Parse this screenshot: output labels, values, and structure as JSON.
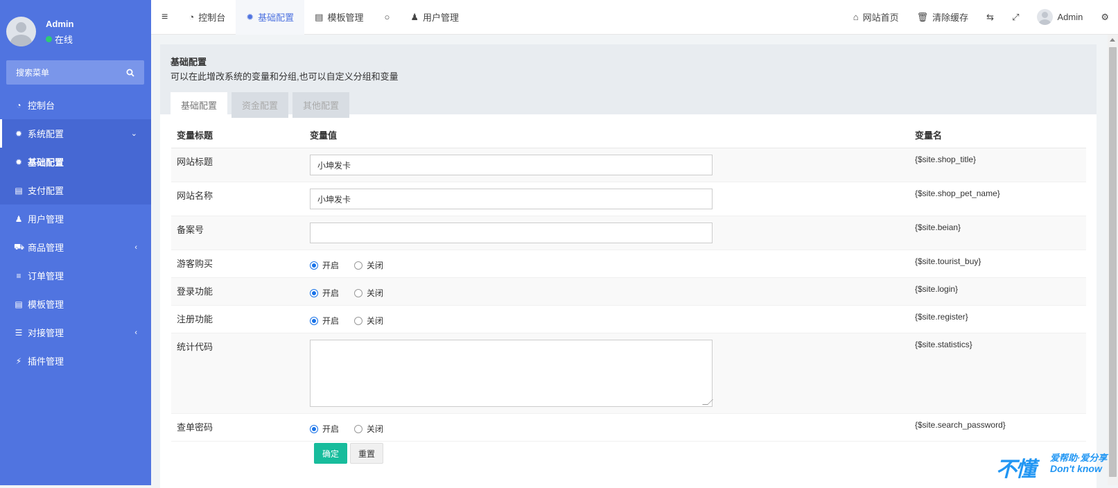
{
  "sidebar": {
    "user": {
      "name": "Admin",
      "status": "在线"
    },
    "search": {
      "label": "搜索菜单"
    },
    "items": [
      {
        "label": "控制台",
        "icon": "dashboard-icon"
      },
      {
        "label": "系统配置",
        "icon": "gear-icon"
      },
      {
        "label": "基础配置",
        "icon": "gear-icon"
      },
      {
        "label": "支付配置",
        "icon": "card-icon"
      },
      {
        "label": "用户管理",
        "icon": "user-icon"
      },
      {
        "label": "商品管理",
        "icon": "cart-icon"
      },
      {
        "label": "订单管理",
        "icon": "list-icon"
      },
      {
        "label": "模板管理",
        "icon": "template-icon"
      },
      {
        "label": "对接管理",
        "icon": "sliders-icon"
      },
      {
        "label": "插件管理",
        "icon": "plug-icon"
      }
    ]
  },
  "topbar": {
    "tabs": [
      {
        "label": "控制台"
      },
      {
        "label": "基础配置"
      },
      {
        "label": "模板管理"
      },
      {
        "label": "用户管理"
      }
    ],
    "right": {
      "home": "网站首页",
      "clear_cache": "清除缓存",
      "admin": "Admin"
    }
  },
  "panel": {
    "title": "基础配置",
    "desc": "可以在此增改系统的变量和分组,也可以自定义分组和变量",
    "tabs": [
      "基础配置",
      "资金配置",
      "其他配置"
    ]
  },
  "table": {
    "headers": {
      "title": "变量标题",
      "value": "变量值",
      "name": "变量名"
    },
    "rows": [
      {
        "title": "网站标题",
        "value": "小坤发卡",
        "name": "{$site.shop_title}"
      },
      {
        "title": "网站名称",
        "value": "小坤发卡",
        "name": "{$site.shop_pet_name}"
      },
      {
        "title": "备案号",
        "value": "",
        "name": "{$site.beian}"
      },
      {
        "title": "游客购买",
        "on": "开启",
        "off": "关闭",
        "name": "{$site.tourist_buy}"
      },
      {
        "title": "登录功能",
        "on": "开启",
        "off": "关闭",
        "name": "{$site.login}"
      },
      {
        "title": "注册功能",
        "on": "开启",
        "off": "关闭",
        "name": "{$site.register}"
      },
      {
        "title": "统计代码",
        "name": "{$site.statistics}"
      },
      {
        "title": "查单密码",
        "on": "开启",
        "off": "关闭",
        "name": "{$site.search_password}"
      }
    ]
  },
  "buttons": {
    "ok": "确定",
    "reset": "重置"
  },
  "watermark": {
    "big": "不懂",
    "small": "爱帮助·爱分享",
    "en": "Don't know"
  }
}
